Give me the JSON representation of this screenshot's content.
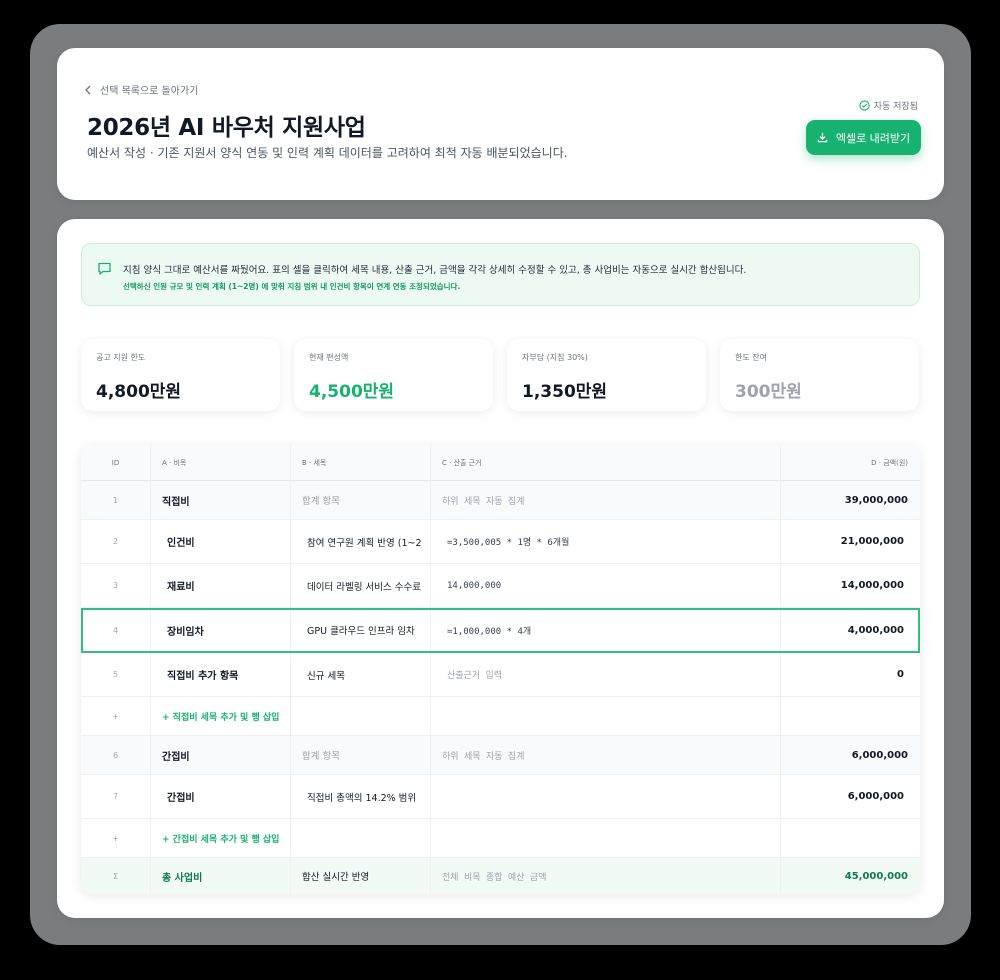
{
  "header": {
    "back_label": "선택 목록으로 돌아가기",
    "title": "2026년 AI 바우처 지원사업",
    "subtitle": "예산서 작성 · 기존 지원서 양식 연동 및 인력 계획 데이터를 고려하여 최적 자동 배분되었습니다.",
    "autosave_label": "자동 저장됨",
    "excel_button_label": "엑셀로 내려받기"
  },
  "notice": {
    "main": "지침 양식 그대로 예산서를 짜뒀어요. 표의 셀을 클릭하여 세목 내용, 산출 근거, 금액을 각각 상세히 수정할 수 있고, 총 사업비는 자동으로 실시간 합산됩니다.",
    "sub": "선택하신 인원 규모 및 인력 계획 (1~2명) 에 맞춰 지침 범위 내 인건비 항목이 연계 연동 조정되었습니다."
  },
  "stats": [
    {
      "label": "공고 지원 한도",
      "value": "4,800만원",
      "tone": "default"
    },
    {
      "label": "현재 편성액",
      "value": "4,500만원",
      "tone": "green"
    },
    {
      "label": "자부담 (지침 30%)",
      "value": "1,350만원",
      "tone": "default"
    },
    {
      "label": "한도 잔여",
      "value": "300만원",
      "tone": "gray"
    }
  ],
  "table": {
    "columns": {
      "id": "ID",
      "a": "A · 비목",
      "b": "B · 세목",
      "c": "C · 산출 근거",
      "d": "D · 금액(원)"
    },
    "rows": [
      {
        "id": "1",
        "a": "직접비",
        "b": "합계 항목",
        "c": "하위 세목 자동 집계",
        "d": "39,000,000"
      },
      {
        "id": "2",
        "a": "인건비",
        "b": "참여 연구원 계획 반영 (1~2",
        "c": "=3,500,005 * 1명 * 6개월",
        "d": "21,000,000"
      },
      {
        "id": "3",
        "a": "재료비",
        "b": "데이터 라벨링 서비스 수수료",
        "c": "14,000,000",
        "d": "14,000,000"
      },
      {
        "id": "4",
        "a": "장비임차",
        "b": "GPU 클라우드 인프라 임차",
        "c": "=1,000,000 * 4개",
        "d": "4,000,000"
      },
      {
        "id": "5",
        "a": "직접비 추가 항목",
        "b": "신규 세목",
        "c": "산출근거 입력",
        "d": "0"
      },
      {
        "id": "+",
        "a": "+ 직접비 세목 추가 및 행 삽입"
      },
      {
        "id": "6",
        "a": "간접비",
        "b": "합계 항목",
        "c": "하위 세목 자동 집계",
        "d": "6,000,000"
      },
      {
        "id": "7",
        "a": "간접비",
        "b": "직접비 총액의 14.2% 범위",
        "c": "",
        "d": "6,000,000"
      },
      {
        "id": "+",
        "a": "+ 간접비 세목 추가 및 행 삽입"
      },
      {
        "id": "Σ",
        "a": "총 사업비",
        "b": "합산 실시간 반영",
        "c": "전체 비목 종합 예산 금액",
        "d": "45,000,000"
      }
    ]
  },
  "colors": {
    "accent": "#17b26f",
    "accent_dark": "#0f7a4a",
    "notice_bg": "#edf9f3"
  }
}
